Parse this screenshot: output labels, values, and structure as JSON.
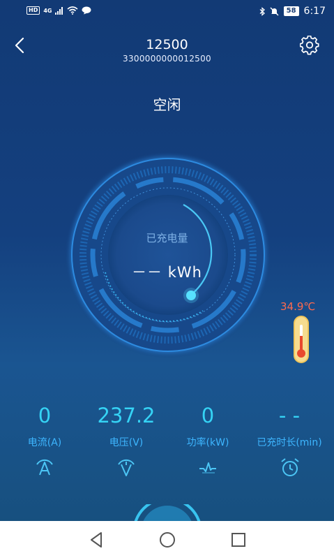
{
  "status_bar": {
    "hd": "HD",
    "network": "4G",
    "battery": "58",
    "time": "6:17"
  },
  "header": {
    "title": "12500",
    "subtitle": "3300000000012500"
  },
  "state": "空闲",
  "gauge": {
    "label": "已充电量",
    "value": "－－ kWh"
  },
  "temperature": "34.9℃",
  "metrics": [
    {
      "value": "0",
      "label": "电流(A)",
      "icon": "current-icon"
    },
    {
      "value": "237.2",
      "label": "电压(V)",
      "icon": "voltage-icon"
    },
    {
      "value": "0",
      "label": "功率(kW)",
      "icon": "power-icon"
    },
    {
      "value": "- -",
      "label": "已充时长(min)",
      "icon": "alarm-clock-icon"
    }
  ],
  "colors": {
    "background_top": "#123a75",
    "metric_value": "#35d3f5",
    "metric_label": "#3db6ff",
    "temperature": "#ff6a4d"
  }
}
